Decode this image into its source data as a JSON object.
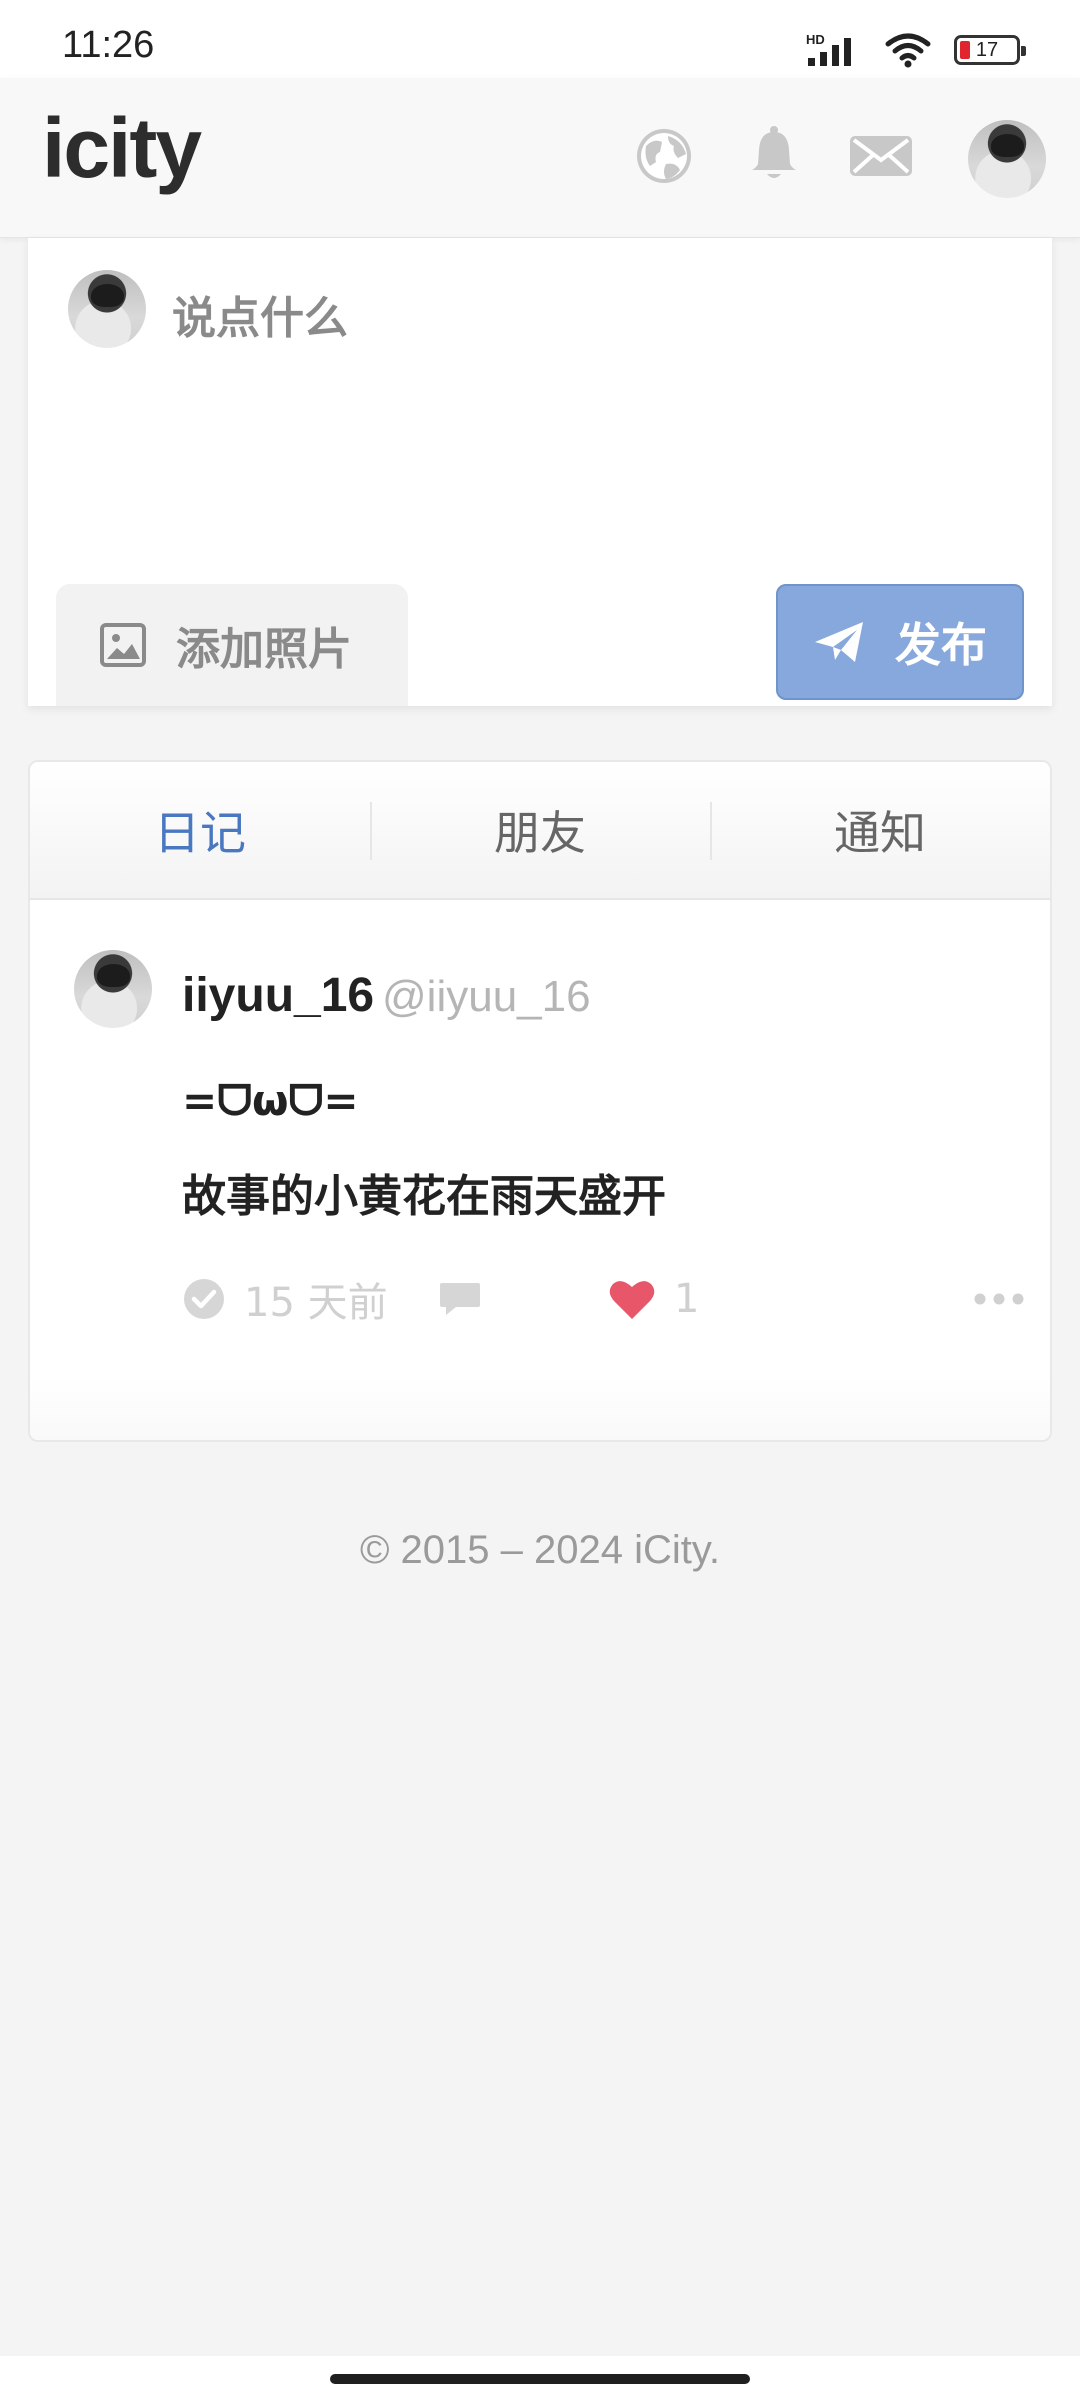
{
  "status_bar": {
    "time": "11:26",
    "network_label": "HD",
    "battery_level": "17",
    "battery_color": "#e0252f"
  },
  "header": {
    "logo": "icity",
    "icons": [
      "globe-icon",
      "bell-icon",
      "mail-icon",
      "avatar"
    ]
  },
  "composer": {
    "placeholder": "说点什么",
    "add_photo_label": "添加照片",
    "publish_label": "发布",
    "publish_color": "#86a8dc"
  },
  "tabs": [
    {
      "label": "日记",
      "active": true
    },
    {
      "label": "朋友",
      "active": false
    },
    {
      "label": "通知",
      "active": false
    }
  ],
  "accent_color": "#4a78c0",
  "post": {
    "username": "iiyuu_16",
    "handle": "@iiyuu_16",
    "lines": [
      "=ᗜωᗜ=",
      "故事的小黄花在雨天盛开"
    ],
    "time_ago": "15 天前",
    "likes": "1",
    "like_color": "#e8566a"
  },
  "footer": {
    "copyright": "© 2015 – 2024 iCity."
  }
}
